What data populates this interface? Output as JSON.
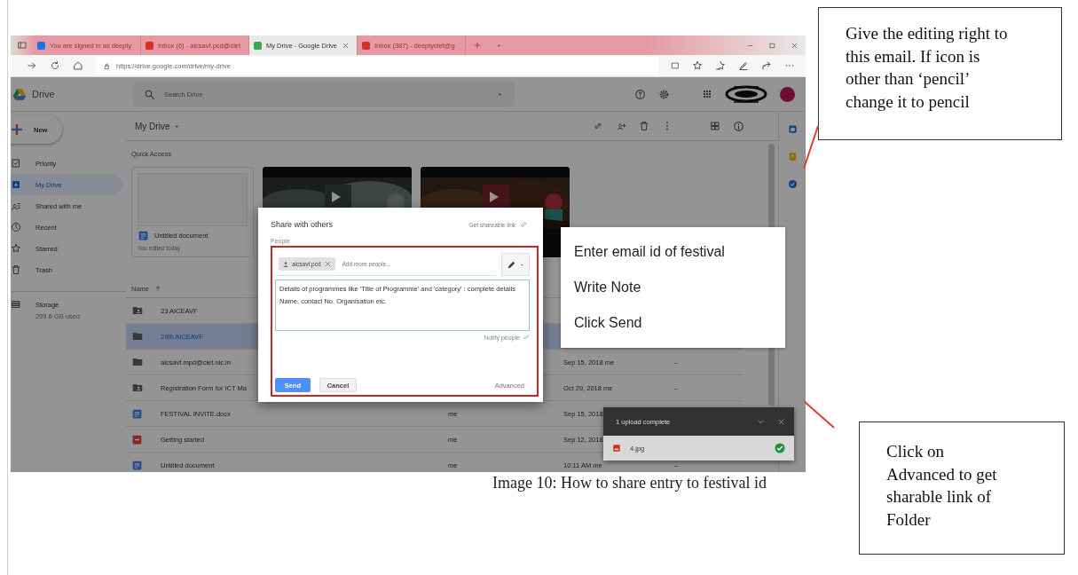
{
  "browser": {
    "tabs": [
      {
        "title": "You are signed in as deepty",
        "selected": false
      },
      {
        "title": "Inbox (6) - aicsavf.pcd@ciet",
        "selected": false
      },
      {
        "title": "My Drive - Google Drive",
        "selected": true
      },
      {
        "title": "Inbox (387) - deeptyciet@g",
        "selected": false
      }
    ],
    "url": "https://drive.google.com/drive/my-drive"
  },
  "drive": {
    "app_name": "Drive",
    "search": {
      "placeholder": "Search Drive"
    },
    "new_button": "New",
    "sidebar": {
      "items": [
        {
          "label": "Priority",
          "selected": false
        },
        {
          "label": "My Drive",
          "selected": true
        },
        {
          "label": "Shared with me",
          "selected": false
        },
        {
          "label": "Recent",
          "selected": false
        },
        {
          "label": "Starred",
          "selected": false
        },
        {
          "label": "Trash",
          "selected": false
        }
      ],
      "storage": {
        "label": "Storage",
        "usage": "209.6 GB used"
      }
    },
    "main": {
      "title": "My Drive",
      "quick_access": {
        "title": "Quick Access",
        "cards": [
          {
            "kind": "document",
            "name": "Untitled document",
            "subtitle": "You edited today"
          },
          {
            "kind": "video"
          },
          {
            "kind": "video"
          }
        ]
      },
      "name_header": "Name",
      "rows": [
        {
          "kind": "shared-folder",
          "name": "23 AICEAVF",
          "selected": false
        },
        {
          "kind": "folder",
          "name": "24th AICEAVF",
          "selected": true
        },
        {
          "kind": "folder",
          "name": "aicsavf.mpd@ciet.nic.in",
          "selected": false,
          "date": "Sep 15, 2018 me",
          "size": "–"
        },
        {
          "kind": "shared-folder",
          "name": "Registration Form for ICT Ma",
          "selected": false,
          "date": "Oct 29, 2018 me",
          "size": "–"
        },
        {
          "kind": "document",
          "name": "FESTIVAL INVITE.docx",
          "selected": false,
          "owner": "me",
          "date": "Sep 15, 2018"
        },
        {
          "kind": "pdf",
          "name": "Getting started",
          "selected": false,
          "owner": "me",
          "date": "Sep 12, 2018"
        },
        {
          "kind": "document",
          "name": "Untitled document",
          "selected": false,
          "owner": "me",
          "date": "10:11 AM me",
          "size": "–"
        }
      ]
    }
  },
  "share_dialog": {
    "title": "Share with others",
    "link_label": "Get shareable link",
    "people_label": "People",
    "chips": [
      "aicsavf.pcd"
    ],
    "add_placeholder": "Add more people...",
    "note": [
      "Details of programmes like 'Title of Programme' and 'category' : complete details",
      "Name, contact No. Organisation etc."
    ],
    "notify": {
      "label": "Notify people",
      "checked": true
    },
    "send": "Send",
    "cancel": "Cancel",
    "advanced": "Advanced"
  },
  "upload_toast": {
    "title": "1 upload complete",
    "files": [
      {
        "name": "4.jpg",
        "done": true
      }
    ]
  },
  "callout": {
    "items": [
      "Enter email id of festival",
      "Write Note",
      "Click Send"
    ]
  },
  "notes": [
    "Give the editing right to this email. If icon is other than ‘pencil’ change it to pencil",
    "Click on Advanced to get sharable link of Folder"
  ],
  "caption": "Image 10: How to share entry to festival id"
}
